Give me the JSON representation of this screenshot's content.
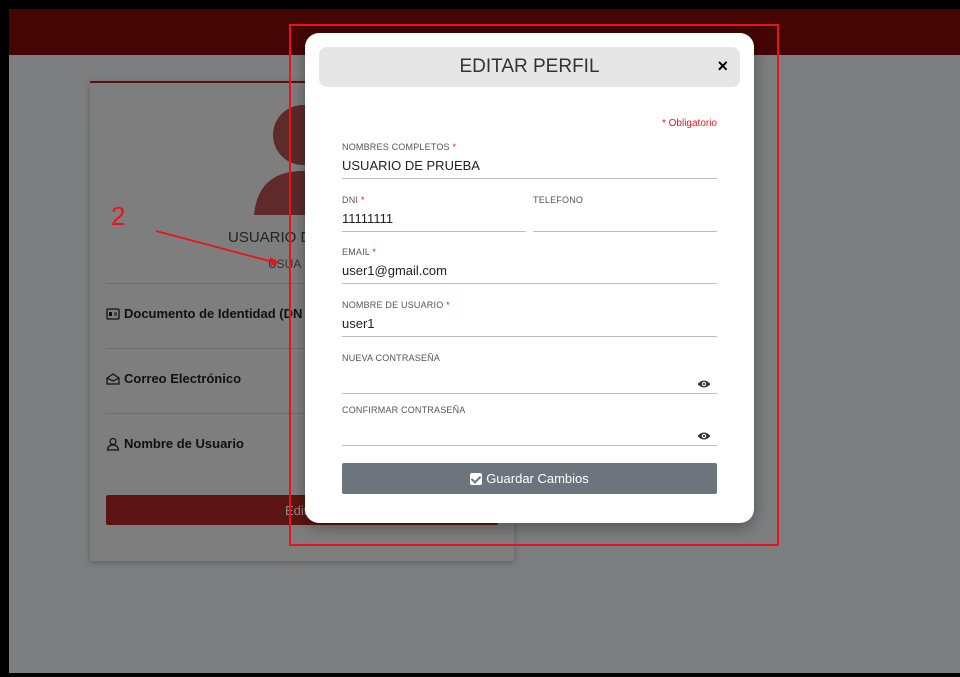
{
  "colors": {
    "topbar": "#450505",
    "accent_red": "#e8141c",
    "save_button": "#6c757d",
    "edit_button": "#5c1512"
  },
  "profile": {
    "name_visible": "USUARIO D",
    "role_visible": "USUA",
    "rows": [
      {
        "icon": "id-card-icon",
        "label": "Documento de Identidad (DN"
      },
      {
        "icon": "envelope-icon",
        "label": "Correo Electrónico"
      },
      {
        "icon": "user-icon",
        "label": "Nombre de Usuario"
      }
    ],
    "edit_button_label": "Editar"
  },
  "annotation": {
    "label": "2"
  },
  "modal": {
    "title": "EDITAR PERFIL",
    "close_label": "×",
    "required_note": "* Obligatorio",
    "fields": {
      "nombres": {
        "label": "NOMBRES COMPLETOS",
        "required": "*",
        "value": "USUARIO DE PRUEBA"
      },
      "dni": {
        "label": "DNI",
        "required": "*",
        "value": "11111111"
      },
      "telefono": {
        "label": "TELEFONO",
        "value": ""
      },
      "email": {
        "label": "EMAIL",
        "required": "*",
        "value": "user1@gmail.com"
      },
      "usuario": {
        "label": "NOMBRE DE USUARIO",
        "required": "*",
        "value": "user1"
      },
      "nueva_pass": {
        "label": "NUEVA CONTRASEÑA",
        "value": ""
      },
      "confirmar_pass": {
        "label": "CONFIRMAR CONTRASEÑA",
        "value": ""
      }
    },
    "save_label": "Guardar Cambios"
  }
}
